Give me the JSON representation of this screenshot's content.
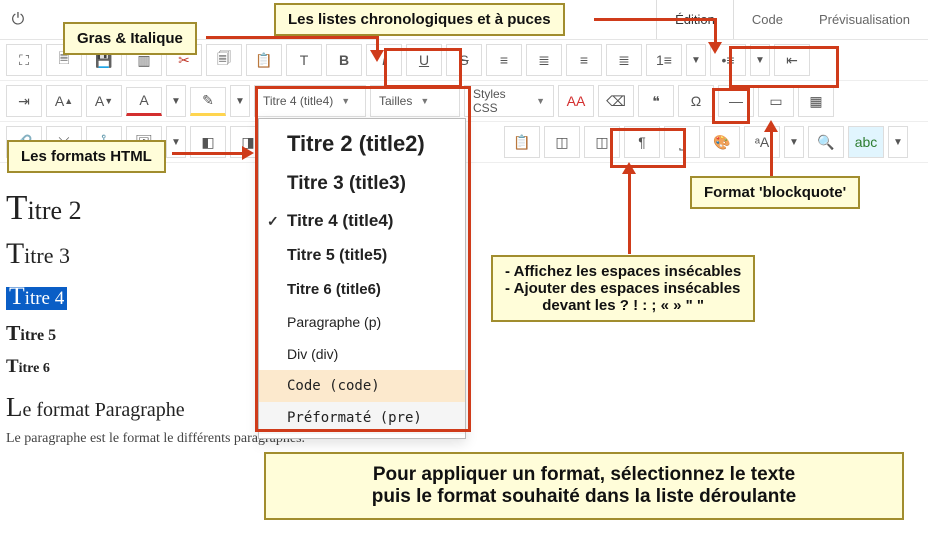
{
  "tabs": {
    "edition": "Édition",
    "code": "Code",
    "preview": "Prévisualisation"
  },
  "callouts": {
    "bold_italic": "Gras & Italique",
    "lists": "Les listes chronologiques et à puces",
    "html_formats": "Les formats HTML",
    "blockquote": "Format 'blockquote'",
    "nbsp_line1": "- Affichez les espaces insécables",
    "nbsp_line2": "- Ajouter des espaces insécables",
    "nbsp_line3": "devant les ? ! : ; « » \" \"",
    "instr_line1": "Pour appliquer un format, sélectionnez le texte",
    "instr_line2": "puis le format souhaité dans la liste déroulante"
  },
  "selects": {
    "format": "Titre 4 (title4)",
    "sizes": "Tailles",
    "styles": "Styles CSS"
  },
  "dropdown": {
    "title2": "Titre 2 (title2)",
    "title3": "Titre 3 (title3)",
    "title4": "Titre 4 (title4)",
    "title5": "Titre 5 (title5)",
    "title6": "Titre 6 (title6)",
    "p": "Paragraphe (p)",
    "div": "Div (div)",
    "code": "Code (code)",
    "pre": "Préformaté (pre)"
  },
  "content": {
    "h2": "Titre 2",
    "h3": "Titre 3",
    "h4": "Titre 4",
    "h5": "Titre 5",
    "h6": "Titre 6",
    "para_heading": "Le format Paragraphe",
    "para_text": "Le paragraphe est le format le différents paragraphes."
  },
  "toolbar": {
    "B": "B",
    "I": "I",
    "U": "U",
    "S": "S",
    "Aplus": "A",
    "Aminus": "A",
    "Acolor": "A",
    "AA": "AA",
    "quote": "❝",
    "omega": "Ω",
    "pilcrow": "¶",
    "abc": "abc",
    "aA": "ᵃA"
  }
}
